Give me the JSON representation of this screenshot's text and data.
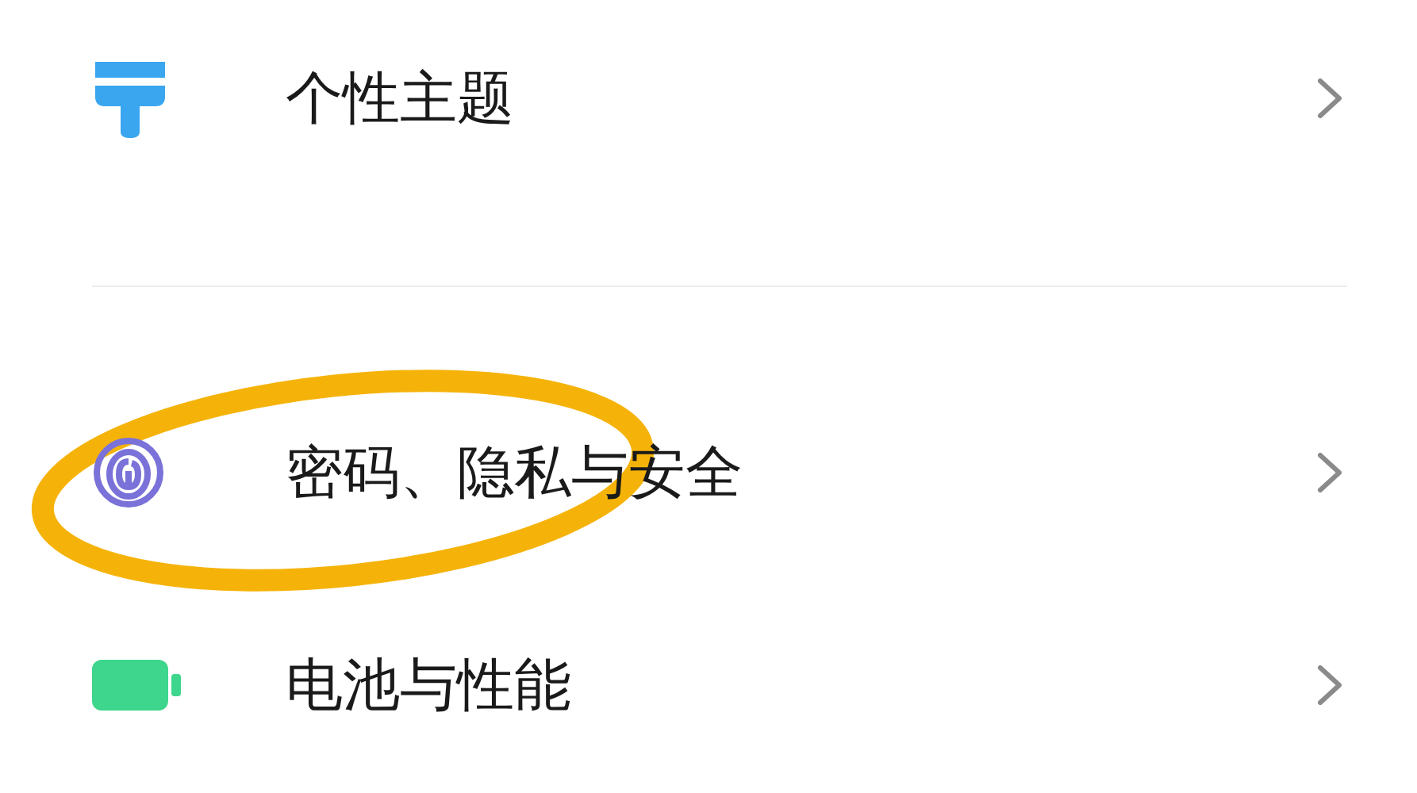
{
  "sections": [
    {
      "items": [
        {
          "kind": "brush",
          "label": "个性主题",
          "highlighted": false
        }
      ]
    },
    {
      "items": [
        {
          "kind": "fingerprint",
          "label": "密码、隐私与安全",
          "highlighted": true
        },
        {
          "kind": "battery",
          "label": "电池与性能",
          "highlighted": false
        }
      ]
    }
  ]
}
